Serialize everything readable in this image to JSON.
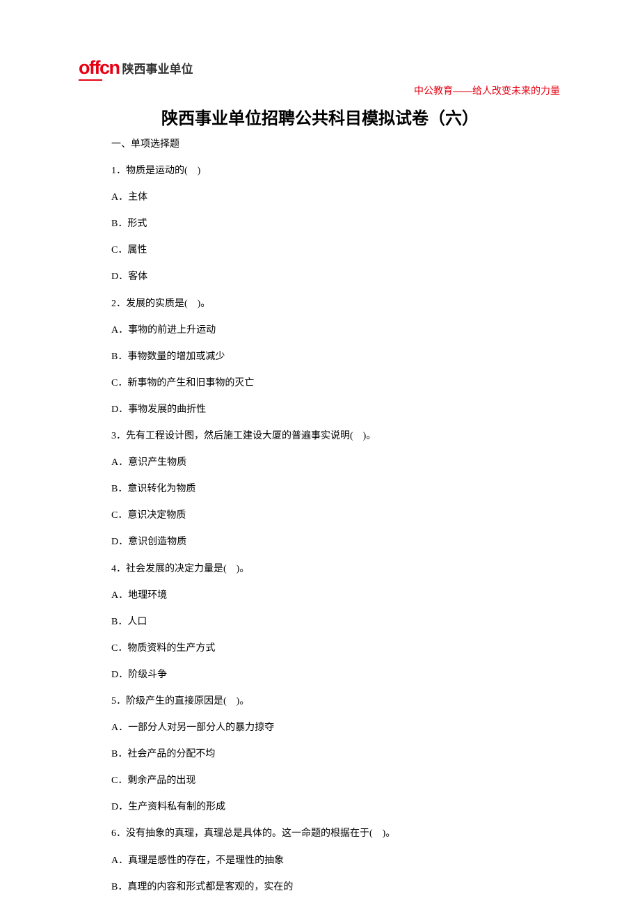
{
  "logo": {
    "brand": "offcn",
    "cn": "陕西事业单位"
  },
  "slogan": "中公教育——给人改变未来的力量",
  "title": "陕西事业单位招聘公共科目模拟试卷（六）",
  "section": "一、单项选择题",
  "questions": [
    {
      "q": "1．物质是运动的(　)",
      "opts": [
        "A．主体",
        "B．形式",
        "C．属性",
        "D．客体"
      ]
    },
    {
      "q": "2．发展的实质是(　)。",
      "opts": [
        "A．事物的前进上升运动",
        "B．事物数量的增加或减少",
        "C．新事物的产生和旧事物的灭亡",
        "D．事物发展的曲折性"
      ]
    },
    {
      "q": "3．先有工程设计图，然后施工建设大厦的普遍事实说明(　)。",
      "opts": [
        "A．意识产生物质",
        "B．意识转化为物质",
        "C．意识决定物质",
        "D．意识创造物质"
      ]
    },
    {
      "q": "4．社会发展的决定力量是(　)。",
      "opts": [
        "A．地理环境",
        "B．人口",
        "C．物质资料的生产方式",
        "D．阶级斗争"
      ]
    },
    {
      "q": "5．阶级产生的直接原因是(　)。",
      "opts": [
        "A．一部分人对另一部分人的暴力掠夺",
        "B．社会产品的分配不均",
        "C．剩余产品的出现",
        "D．生产资料私有制的形成"
      ]
    },
    {
      "q": "6．没有抽象的真理，真理总是具体的。这一命题的根据在于(　)。",
      "opts": [
        "A．真理是感性的存在，不是理性的抽象",
        "B．真理的内容和形式都是客观的，实在的"
      ]
    }
  ]
}
